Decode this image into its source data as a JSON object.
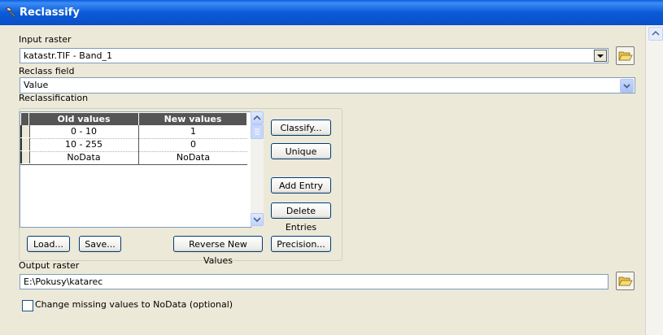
{
  "window": {
    "title": "Reclassify",
    "icon": "hammer-icon"
  },
  "input_raster": {
    "label": "Input raster",
    "value": "katastr.TIF - Band_1"
  },
  "reclass_field": {
    "label": "Reclass field",
    "value": "Value"
  },
  "reclassification": {
    "label": "Reclassification",
    "columns": [
      "Old values",
      "New values"
    ],
    "rows": [
      {
        "old": "0 - 10",
        "new": "1"
      },
      {
        "old": "10 - 255",
        "new": "0"
      },
      {
        "old": "NoData",
        "new": "NoData"
      }
    ]
  },
  "buttons": {
    "classify": "Classify...",
    "unique": "Unique",
    "add_entry": "Add Entry",
    "delete_entries": "Delete Entries",
    "load": "Load...",
    "save": "Save...",
    "reverse": "Reverse New Values",
    "precision": "Precision..."
  },
  "output_raster": {
    "label": "Output raster",
    "value": "E:\\Pokusy\\katarec"
  },
  "missing_values": {
    "label": "Change missing values to NoData (optional)",
    "checked": false
  },
  "icons": {
    "folder": "folder-open-icon",
    "dropdown": "chevron-down-icon"
  }
}
